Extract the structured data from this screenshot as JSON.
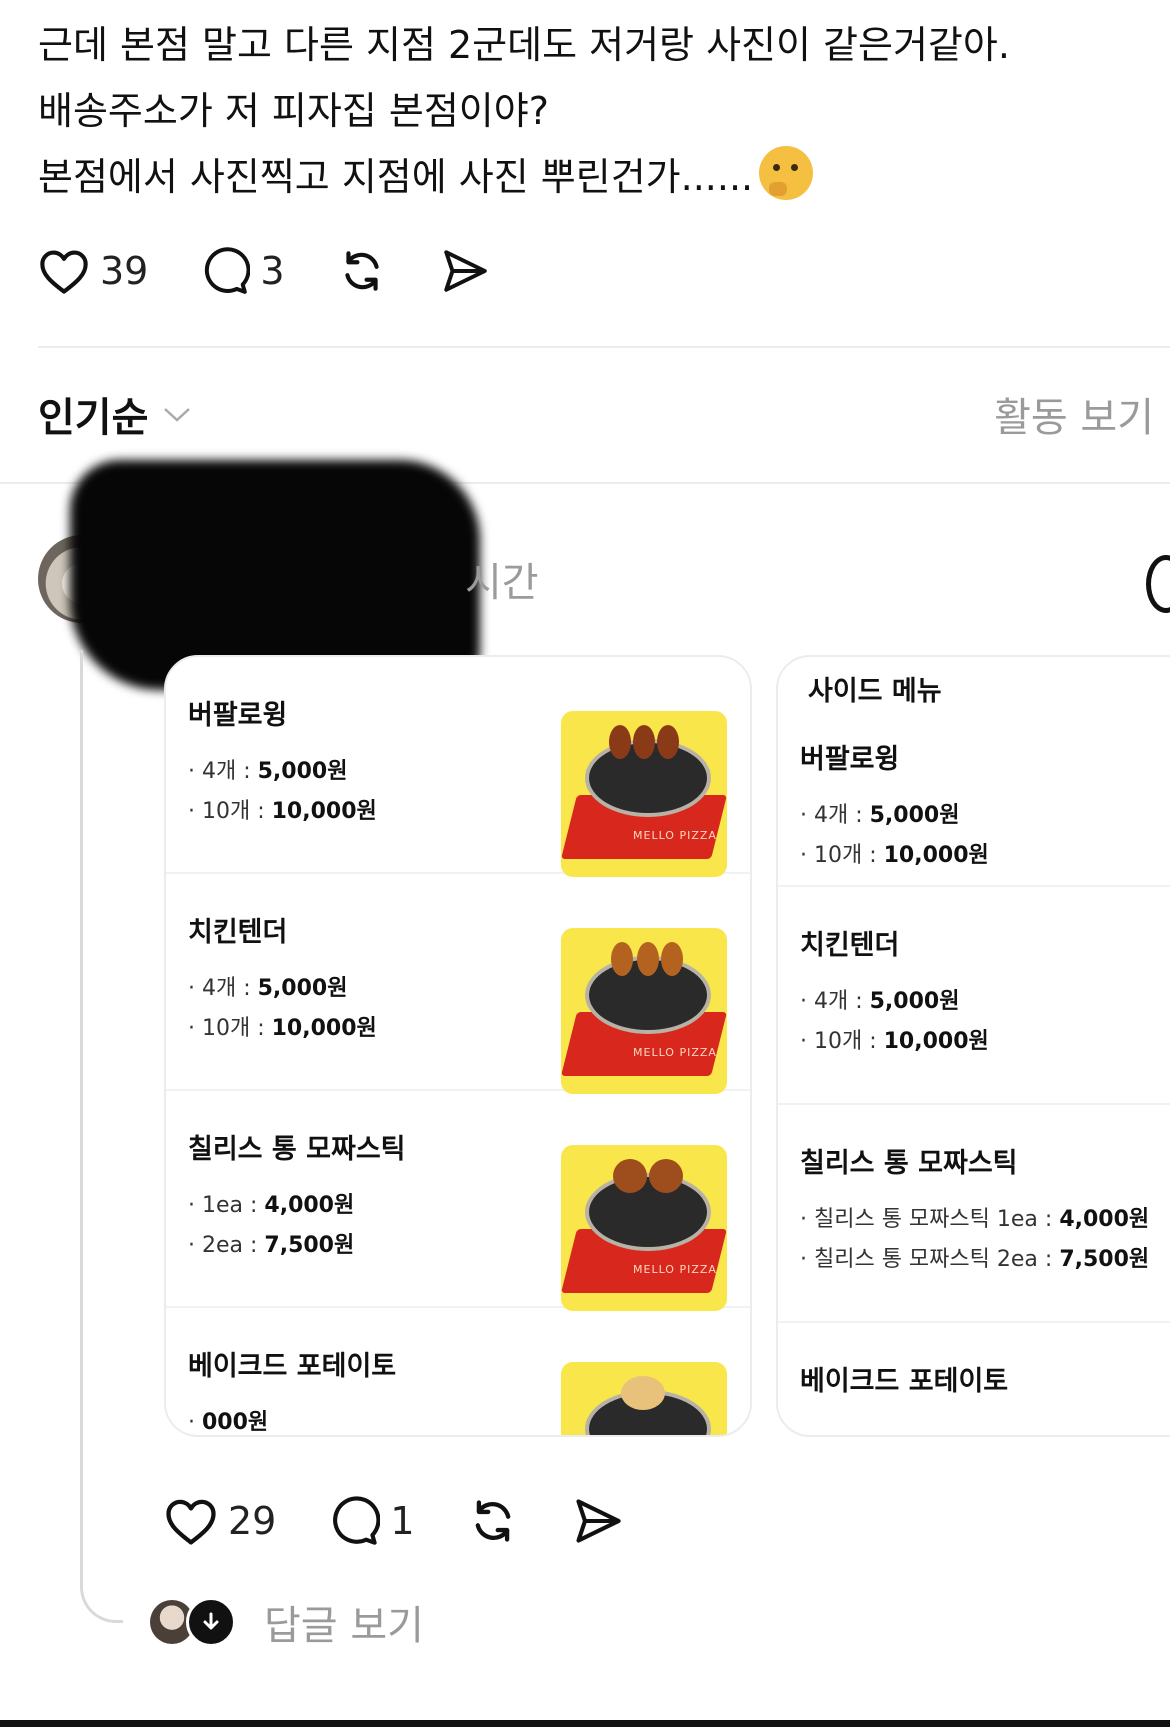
{
  "post": {
    "line1": "근데 본점 말고 다른 지점 2군데도 저거랑 사진이 같은거같아.",
    "line2": "배송주소가 저 피자집 본점이야?",
    "line3": "본점에서 사진찍고 지점에 사진 뿌린건가......",
    "emoji": "thinking-face-icon",
    "likes": "39",
    "comments": "3"
  },
  "sort": {
    "label": "인기순",
    "activity": "활동 보기"
  },
  "comment": {
    "time_fragment": "시간",
    "likes": "29",
    "comments": "1",
    "view_replies": "답글 보기"
  },
  "menu_left": {
    "items": [
      {
        "name": "버팔로윙",
        "l1_label": "· 4개 : ",
        "l1_price": "5,000원",
        "l2_label": "· 10개 : ",
        "l2_price": "10,000원"
      },
      {
        "name": "치킨텐더",
        "l1_label": "· 4개 : ",
        "l1_price": "5,000원",
        "l2_label": "· 10개 : ",
        "l2_price": "10,000원"
      },
      {
        "name": "칠리스 통 모짜스틱",
        "l1_label": "· 1ea : ",
        "l1_price": "4,000원",
        "l2_label": "· 2ea : ",
        "l2_price": "7,500원"
      },
      {
        "name": "베이크드 포테이토",
        "l1_label": "· ",
        "l1_price": "000원"
      }
    ],
    "photo_logo": "MELLO PIZZA"
  },
  "menu_right": {
    "header": "사이드 메뉴",
    "items": [
      {
        "name": "버팔로윙",
        "l1_label": "· 4개 : ",
        "l1_price": "5,000원",
        "l2_label": "· 10개 : ",
        "l2_price": "10,000원"
      },
      {
        "name": "치킨텐더",
        "l1_label": "· 4개 : ",
        "l1_price": "5,000원",
        "l2_label": "· 10개 : ",
        "l2_price": "10,000원"
      },
      {
        "name": "칠리스 통 모짜스틱",
        "l1_label": "· 칠리스 통 모짜스틱 1ea : ",
        "l1_price": "4,000원",
        "l2_label": "· 칠리스 통 모짜스틱 2ea : ",
        "l2_price": "7,500원"
      },
      {
        "name": "베이크드 포테이토"
      }
    ]
  },
  "colors": {
    "photo_bg": "#f9e64a",
    "box_red": "#d8271d",
    "muted_text": "#9a9a9a"
  }
}
